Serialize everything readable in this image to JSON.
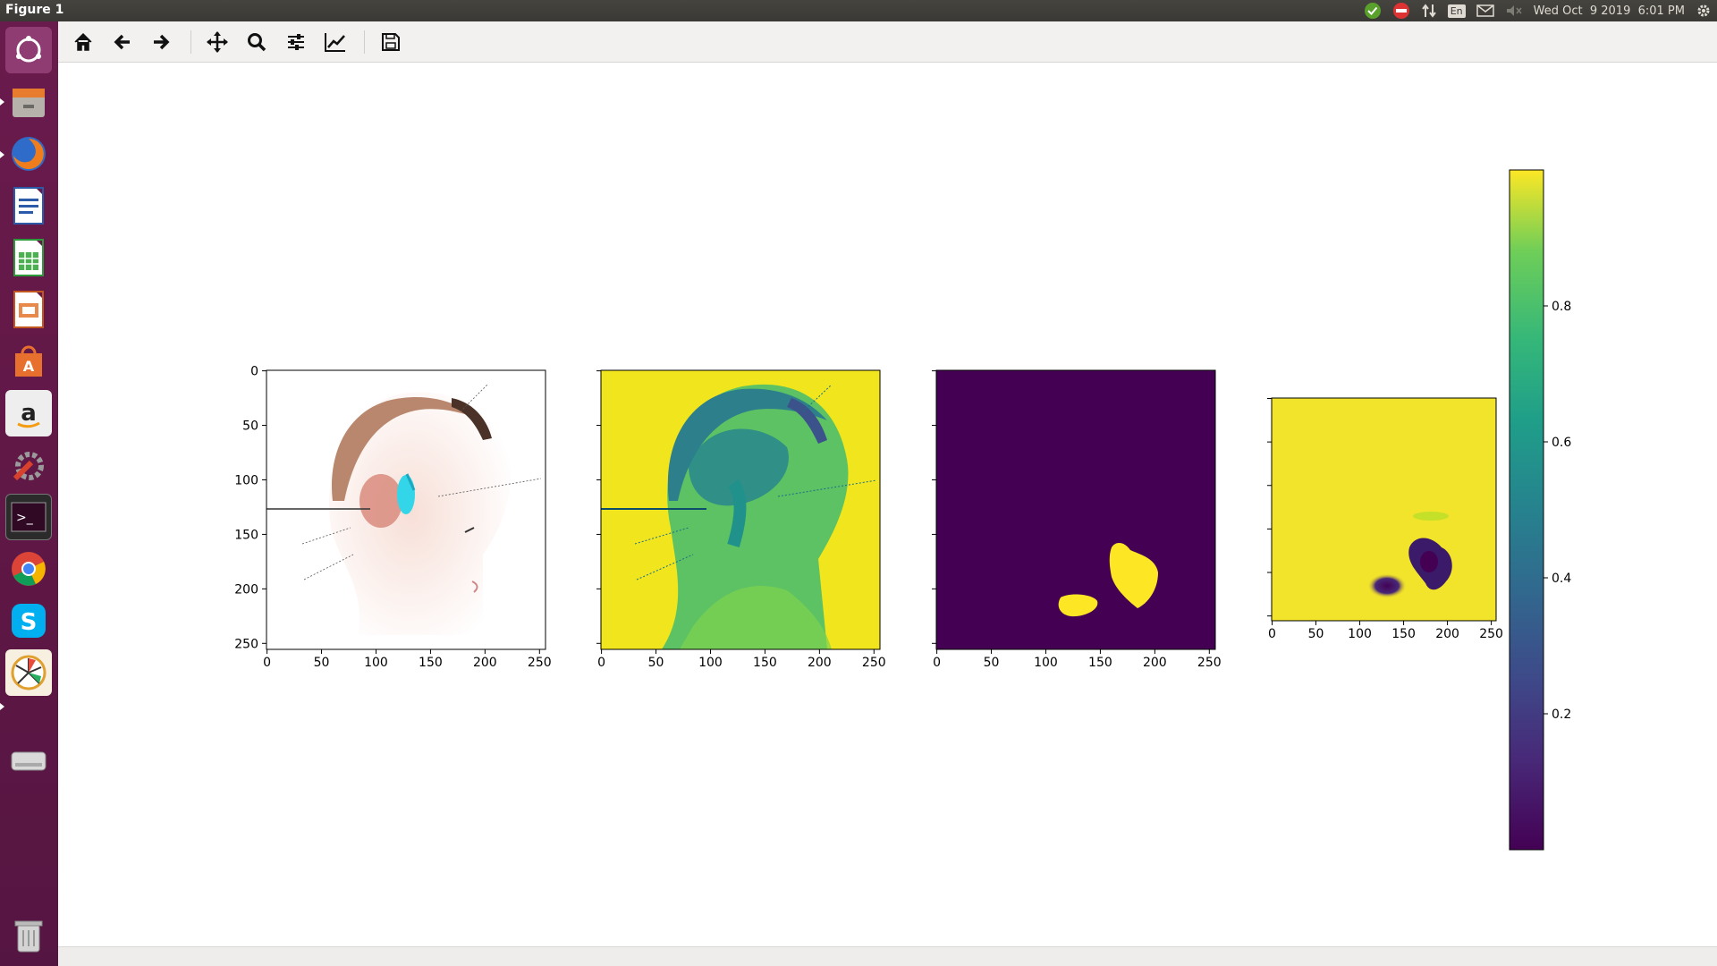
{
  "window": {
    "title": "Figure 1"
  },
  "system_tray": {
    "language": "En",
    "clock": "Wed Oct  9 2019  6:01 PM",
    "icons": [
      "status-ok-icon",
      "no-entry-icon",
      "network-arrows-icon",
      "keyboard-language-icon",
      "mail-icon",
      "volume-muted-icon",
      "settings-gear-icon"
    ]
  },
  "launcher": {
    "items": [
      "ubuntu-dash",
      "files",
      "firefox",
      "libreoffice-writer",
      "libreoffice-calc",
      "libreoffice-impress",
      "software-center",
      "amazon",
      "system-settings",
      "terminal",
      "chrome",
      "skype",
      "gimp-pinwheel",
      "disk-drive",
      "trash"
    ]
  },
  "toolbar": {
    "buttons": [
      "home",
      "back",
      "forward",
      "pan",
      "zoom",
      "subplots",
      "customize",
      "save"
    ]
  },
  "figure": {
    "subplots": [
      {
        "type": "image",
        "content": "RGB anatomical head illustration (high-contrast)",
        "xticks": [
          "0",
          "50",
          "100",
          "150",
          "200",
          "250"
        ],
        "yticks": [
          "0",
          "50",
          "100",
          "150",
          "200",
          "250"
        ]
      },
      {
        "type": "image",
        "content": "single-channel anatomical head illustration (viridis)",
        "xticks": [
          "0",
          "50",
          "100",
          "150",
          "200",
          "250"
        ]
      },
      {
        "type": "image",
        "content": "binary mask with two yellow blobs",
        "xticks": [
          "0",
          "50",
          "100",
          "150",
          "200",
          "250"
        ]
      },
      {
        "type": "image",
        "content": "probability map, mostly yellow with two dark blobs",
        "xticks": [
          "0",
          "50",
          "100",
          "150",
          "200",
          "250"
        ]
      }
    ],
    "colorbar": {
      "ticks": [
        "0.2",
        "0.4",
        "0.6",
        "0.8"
      ],
      "colormap": "viridis",
      "range": [
        0.0,
        1.0
      ]
    }
  }
}
